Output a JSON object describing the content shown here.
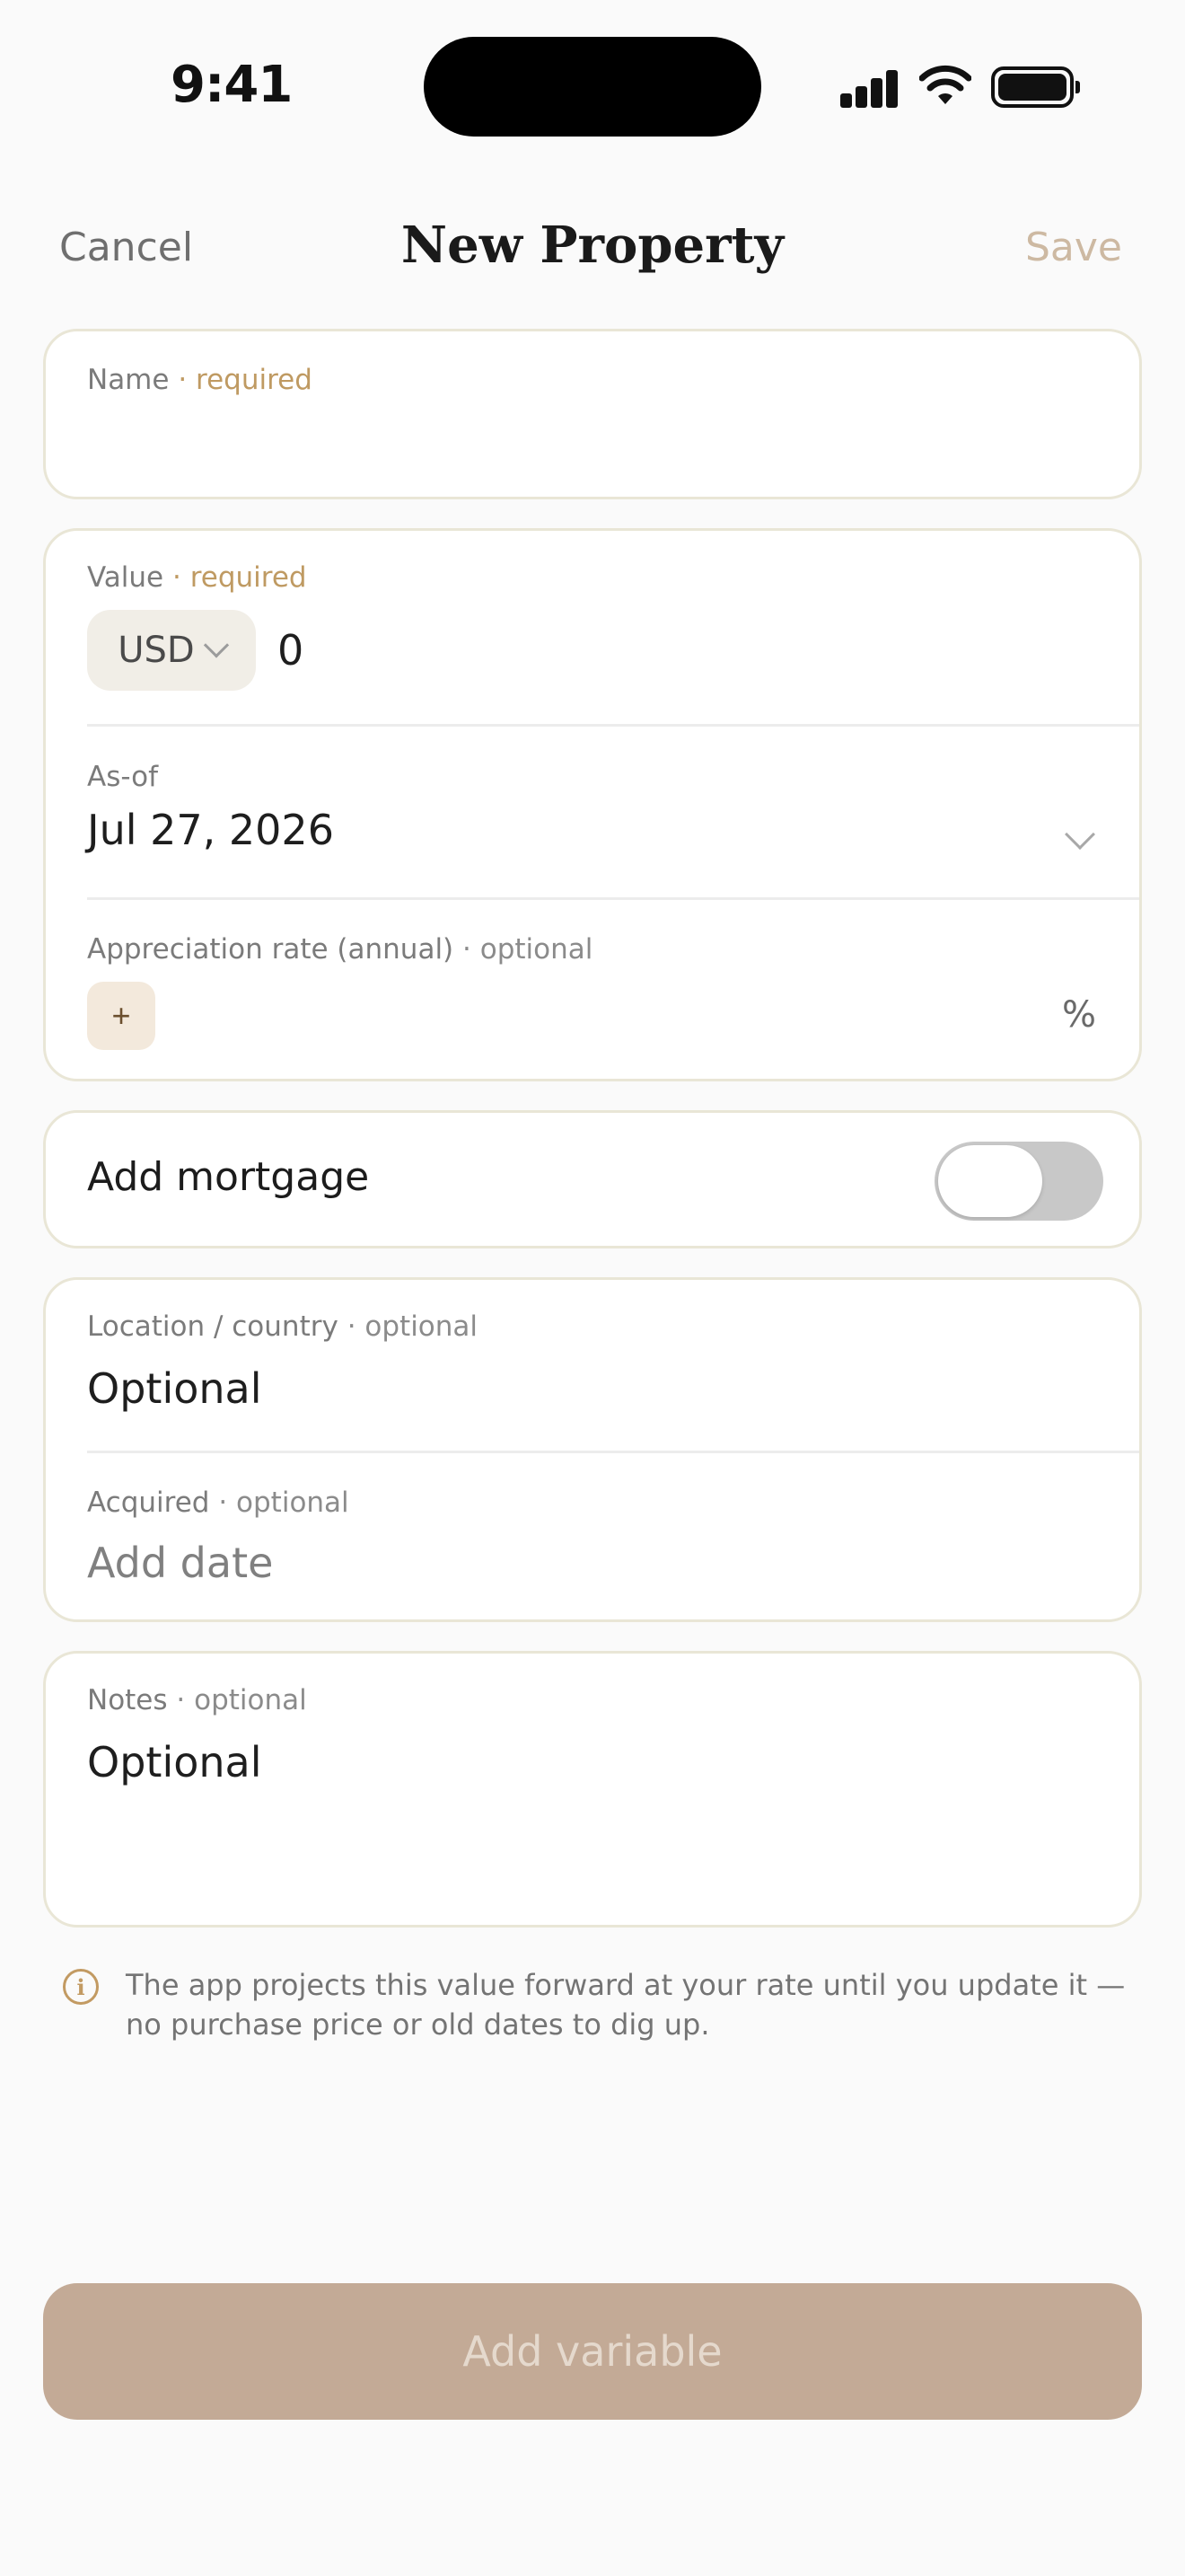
{
  "status_bar": {
    "time": "9:41"
  },
  "nav": {
    "cancel": "Cancel",
    "title": "New Property",
    "save": "Save"
  },
  "name_field": {
    "label": "Name",
    "tag": "· required",
    "value": ""
  },
  "value_field": {
    "label": "Value",
    "tag": "· required",
    "currency": "USD",
    "placeholder": "0"
  },
  "as_of": {
    "label": "As-of",
    "value": "Jul 27, 2026"
  },
  "appreciation": {
    "label": "Appreciation rate (annual)",
    "tag": "· optional",
    "sign_button": "+",
    "unit": "%"
  },
  "mortgage": {
    "label": "Add mortgage",
    "enabled": false
  },
  "location": {
    "label": "Location / country",
    "tag": "· optional",
    "placeholder": "Optional"
  },
  "acquired": {
    "label": "Acquired",
    "tag": "· optional",
    "value": "Add date"
  },
  "notes": {
    "label": "Notes",
    "tag": "· optional",
    "placeholder": "Optional"
  },
  "info": {
    "icon": "info-icon",
    "text": "The app projects this value forward at your rate until you update it — no purchase price or old dates to dig up."
  },
  "cta": {
    "label": "Add variable"
  },
  "colors": {
    "accent": "#bf9a62",
    "cta_bg": "#c3aa96",
    "card_border": "#e9e6d6"
  }
}
